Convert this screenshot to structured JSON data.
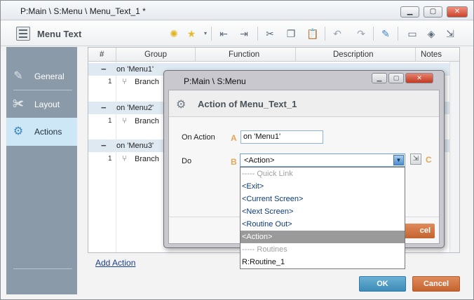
{
  "window": {
    "title": "P:Main \\ S:Menu \\ Menu_Text_1 *"
  },
  "toolbar": {
    "title": "Menu Text"
  },
  "nav": {
    "items": [
      {
        "label": "General",
        "icon": "pencil-icon"
      },
      {
        "label": "Layout",
        "icon": "wrench-icon"
      },
      {
        "label": "Actions",
        "icon": "gears-icon",
        "active": true
      }
    ]
  },
  "grid": {
    "columns": [
      "#",
      "Group",
      "Function",
      "Description",
      "Notes"
    ],
    "groups": [
      {
        "name": "on 'Menu1'",
        "rows": [
          {
            "num": "1",
            "group": "Branch"
          }
        ]
      },
      {
        "name": "on 'Menu2'",
        "rows": [
          {
            "num": "1",
            "group": "Branch"
          }
        ]
      },
      {
        "name": "on 'Menu3'",
        "rows": [
          {
            "num": "1",
            "group": "Branch"
          }
        ]
      }
    ]
  },
  "add_action": "Add Action",
  "buttons": {
    "ok": "OK",
    "cancel": "Cancel"
  },
  "dialog": {
    "title": "P:Main \\ S:Menu",
    "header": "Action of Menu_Text_1",
    "on_action_label": "On Action",
    "on_action_value": "on 'Menu1'",
    "letter_a": "A",
    "do_label": "Do",
    "letter_b": "B",
    "letter_c": "C",
    "do_value": "<Action>",
    "cancel_partial": "cel",
    "options": [
      {
        "label": "----- Quick Link",
        "kind": "sep"
      },
      {
        "label": "<Exit>",
        "kind": "opt"
      },
      {
        "label": "<Current Screen>",
        "kind": "opt"
      },
      {
        "label": "<Next Screen>",
        "kind": "opt"
      },
      {
        "label": "<Routine Out>",
        "kind": "opt"
      },
      {
        "label": "<Action>",
        "kind": "sel"
      },
      {
        "label": "----- Routines",
        "kind": "sep"
      },
      {
        "label": "R:Routine_1",
        "kind": "plain"
      }
    ]
  },
  "colors": {
    "ok": "#3d8bb7",
    "cancel": "#c4642f",
    "nav": "#8b9aa8",
    "nav_active": "#cde7f6",
    "accent_letter": "#e0a75a"
  }
}
